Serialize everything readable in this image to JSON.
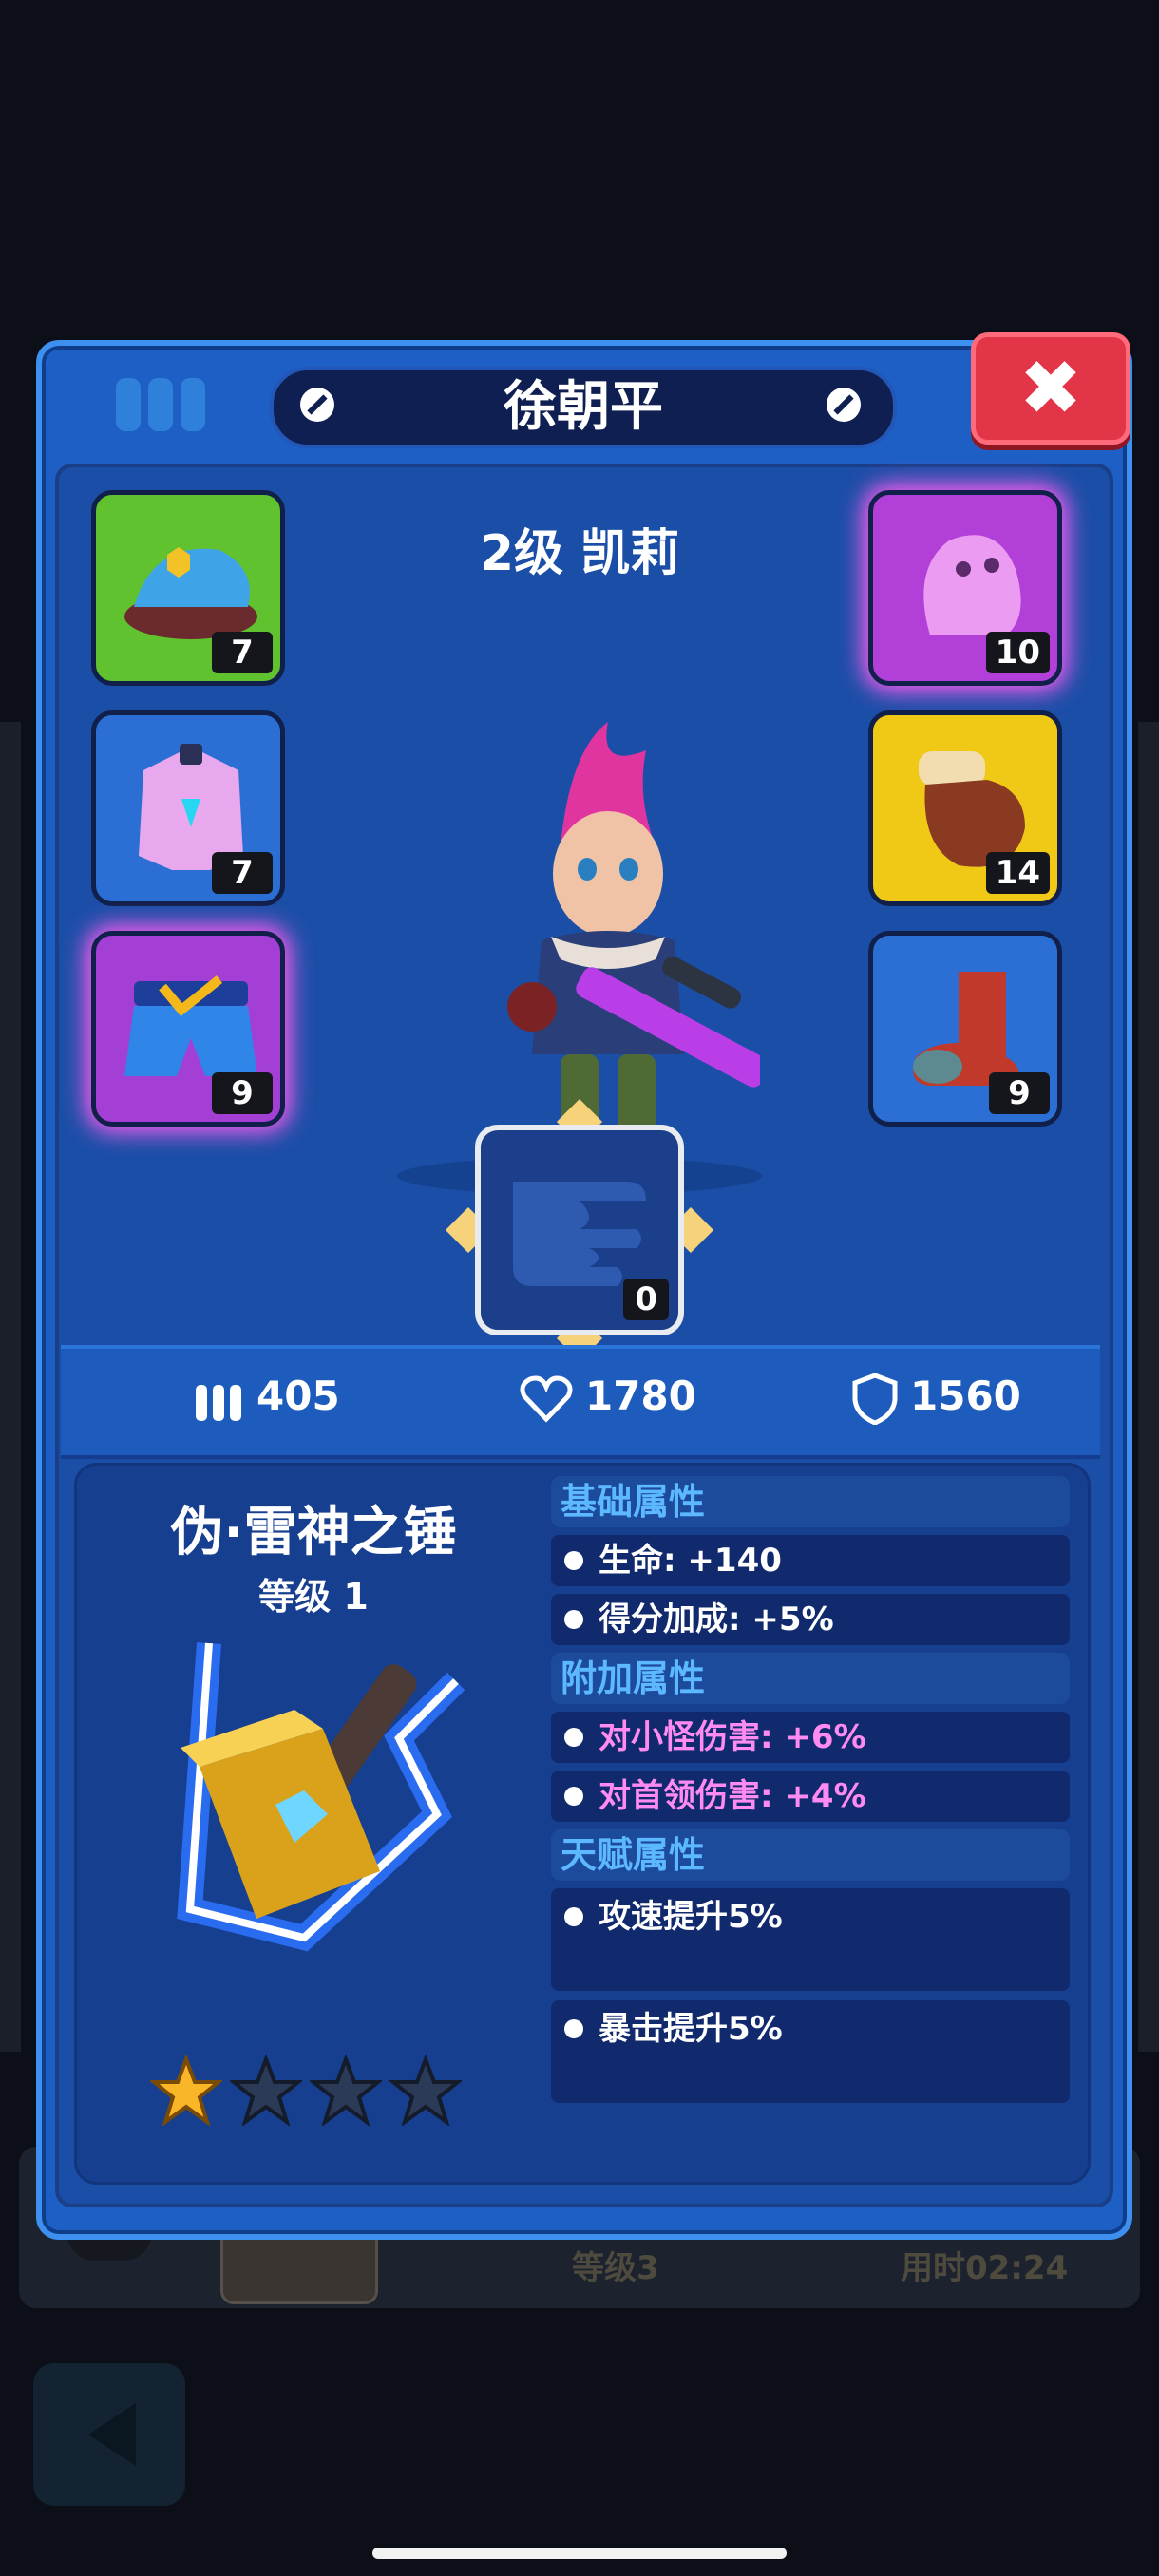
{
  "modal": {
    "player_name": "徐朝平",
    "hero_title": "2级 凯莉",
    "close_label": "✖"
  },
  "equipment_left": [
    {
      "icon": "police-cap-icon",
      "level": "7",
      "color": "#5fc22e"
    },
    {
      "icon": "pink-vest-icon",
      "level": "7",
      "color": "#2b6fd4"
    },
    {
      "icon": "blue-shorts-icon",
      "level": "9",
      "color": "#a43fd6"
    }
  ],
  "equipment_right": [
    {
      "icon": "ghost-icon",
      "level": "10",
      "color": "#b13fd8"
    },
    {
      "icon": "glove-icon",
      "level": "14",
      "color": "#f0c916"
    },
    {
      "icon": "boot-icon",
      "level": "9",
      "color": "#2b6fd4"
    }
  ],
  "weapon_slot": {
    "level": "0"
  },
  "stats": {
    "attack": "405",
    "health": "1780",
    "defense": "1560"
  },
  "item": {
    "name": "伪·雷神之锤",
    "level": "等级 1",
    "stars_filled": 1,
    "stars_total": 4
  },
  "attributes": {
    "base_header": "基础属性",
    "base_1": "生命: +140",
    "base_2": "得分加成: +5%",
    "extra_header": "附加属性",
    "extra_1": "对小怪伤害: +6%",
    "extra_2": "对首领伤害: +4%",
    "talent_header": "天赋属性",
    "talent_1": "攻速提升5%",
    "talent_2": "暴击提升5%"
  },
  "background": {
    "level_text": "等级3",
    "time_text": "用时02:24"
  }
}
